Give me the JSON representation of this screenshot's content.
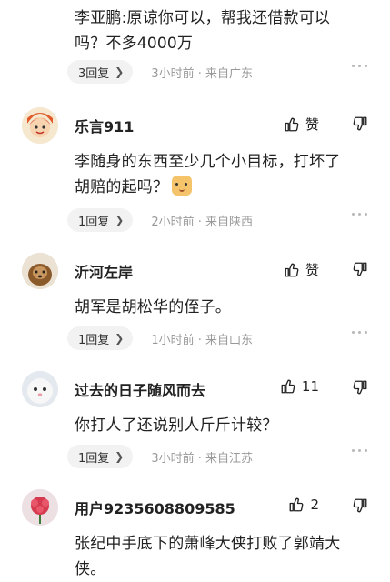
{
  "top_comment": {
    "text_line1": "李亚鹏:原谅你可以，帮我还借款可以",
    "text_line2": "吗？不多4000万",
    "reply_count": "3回复",
    "time_location": "3小时前 · 来自广东"
  },
  "comments": [
    {
      "username": "乐言911",
      "like_label": "赞",
      "text_line1": "李随身的东西至少几个小目标，打坏了",
      "text_line2": "胡赔的起吗？",
      "reply_count": "1回复",
      "time_location": "2小时前 · 来自陕西",
      "has_emoji": true
    },
    {
      "username": "沂河左岸",
      "like_label": "赞",
      "text_line1": "胡军是胡松华的侄子。",
      "reply_count": "1回复",
      "time_location": "1小时前 · 来自山东"
    },
    {
      "username": "过去的日子随风而去",
      "like_label": "11",
      "text_line1": "你打人了还说别人斤斤计较？",
      "reply_count": "1回复",
      "time_location": "3小时前 · 来自江苏"
    },
    {
      "username": "用户9235608809585",
      "like_label": "2",
      "text_line1": "张纪中手底下的萧峰大侠打败了郭靖大",
      "text_line2": "侠。"
    }
  ],
  "icons": {
    "like": "thumbs-up-icon",
    "dislike": "thumbs-down-icon",
    "more": "more-dots-icon",
    "chevron": "chevron-right-icon"
  }
}
